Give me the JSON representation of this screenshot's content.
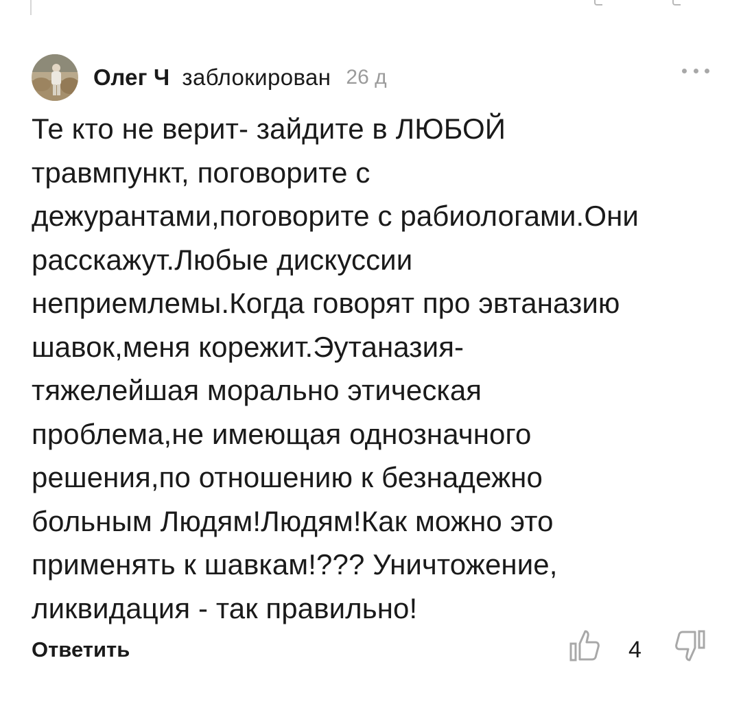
{
  "comment": {
    "author": "Олег Ч",
    "status": "заблокирован",
    "time": "26 д",
    "text": "Те кто не верит- зайдите в ЛЮБОЙ\nтравмпункт, поговорите с\nдежурантами,поговорите с рабиологами.Они\nрасскажут.Любые дискуссии\nнеприемлемы.Когда говорят про эвтаназию\nшавок,меня корежит.Эутаназия-\nтяжелейшая морально этическая\nпроблема,не имеющая однозначного\nрешения,по отношению к безнадежно\nбольным Людям!Людям!Как можно это\nприменять к шавкам!??? Уничтожение,\nликвидация - так правильно!",
    "reply_label": "Ответить",
    "likes": "4"
  },
  "icons": {
    "more": "more-dots-icon",
    "like": "thumb-up-icon",
    "dislike": "thumb-down-icon"
  },
  "colors": {
    "text": "#1a1a1a",
    "muted": "#9b9b9b",
    "icon": "#a8a8a8"
  }
}
